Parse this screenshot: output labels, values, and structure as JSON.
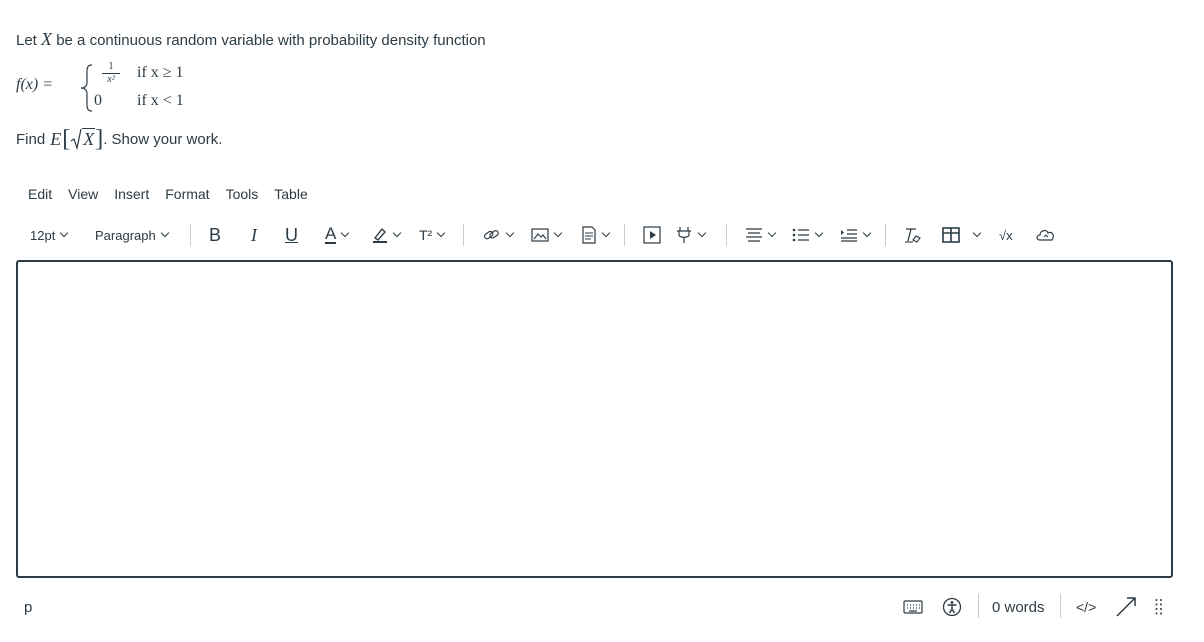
{
  "question": {
    "intro_prefix": "Let",
    "intro_var": "X",
    "intro_suffix": "be a continuous random variable with probability density function",
    "pdf_lhs": "f(x) =",
    "case1_num": "1",
    "case1_den": "x²",
    "case1_cond": "if x ≥ 1",
    "case2_val": "0",
    "case2_cond": "if x < 1",
    "find_prefix": "Find",
    "find_expr_E": "E",
    "find_expr_X": "X",
    "find_suffix": ". Show your work."
  },
  "menubar": {
    "edit": "Edit",
    "view": "View",
    "insert": "Insert",
    "format": "Format",
    "tools": "Tools",
    "table": "Table"
  },
  "toolbar": {
    "font_size": "12pt",
    "block_format": "Paragraph",
    "bold": "B",
    "italic": "I",
    "underline": "U",
    "text_color": "A",
    "superscript": "T²",
    "equation": "√x"
  },
  "statusbar": {
    "element_path": "p",
    "word_count": "0 words",
    "html_toggle": "</>"
  },
  "colors": {
    "text": "#2d3b45",
    "border": "#2d3b45",
    "separator": "#c7cdd1"
  }
}
